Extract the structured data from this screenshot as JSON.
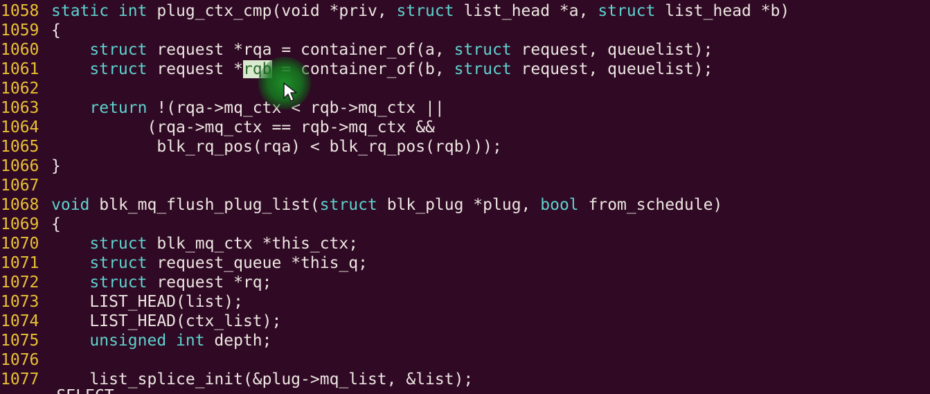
{
  "editor": {
    "background": "#300a24",
    "line_number_color": "#e8c232",
    "keyword_color": "#5ed2cf",
    "text_color": "#ede6e2",
    "status_text": "-- SELECT --"
  },
  "cursor": {
    "icon": "mouse-pointer-icon",
    "highlight": "green-click-highlight"
  },
  "lines": [
    {
      "num": "1058",
      "parts": [
        [
          "kw",
          "static int "
        ],
        [
          "txt",
          "plug_ctx_cmp(void *priv, "
        ],
        [
          "kw",
          "struct "
        ],
        [
          "txt",
          "list_head *a, "
        ],
        [
          "kw",
          "struct "
        ],
        [
          "txt",
          "list_head *b)"
        ]
      ]
    },
    {
      "num": "1059",
      "parts": [
        [
          "txt",
          "{"
        ]
      ]
    },
    {
      "num": "1060",
      "parts": [
        [
          "txt",
          "    "
        ],
        [
          "kw",
          "struct "
        ],
        [
          "txt",
          "request *rqa = container_of(a, "
        ],
        [
          "kw",
          "struct "
        ],
        [
          "txt",
          "request, queuelist);"
        ]
      ]
    },
    {
      "num": "1061",
      "parts": [
        [
          "txt",
          "    "
        ],
        [
          "kw",
          "struct "
        ],
        [
          "txt",
          "request *"
        ],
        [
          "hl",
          "rqb"
        ],
        [
          "txt",
          " = container_of(b, "
        ],
        [
          "kw",
          "struct "
        ],
        [
          "txt",
          "request, queuelist);"
        ]
      ]
    },
    {
      "num": "1062",
      "parts": [
        [
          "txt",
          ""
        ]
      ]
    },
    {
      "num": "1063",
      "parts": [
        [
          "txt",
          "    "
        ],
        [
          "kw",
          "return "
        ],
        [
          "txt",
          "!(rqa->mq_ctx < rqb->mq_ctx ||"
        ]
      ]
    },
    {
      "num": "1064",
      "parts": [
        [
          "txt",
          "          (rqa->mq_ctx == rqb->mq_ctx &&"
        ]
      ]
    },
    {
      "num": "1065",
      "parts": [
        [
          "txt",
          "           blk_rq_pos(rqa) < blk_rq_pos(rqb)));"
        ]
      ]
    },
    {
      "num": "1066",
      "parts": [
        [
          "txt",
          "}"
        ]
      ]
    },
    {
      "num": "1067",
      "parts": [
        [
          "txt",
          ""
        ]
      ]
    },
    {
      "num": "1068",
      "parts": [
        [
          "kw",
          "void "
        ],
        [
          "txt",
          "blk_mq_flush_plug_list("
        ],
        [
          "kw",
          "struct "
        ],
        [
          "txt",
          "blk_plug *plug, "
        ],
        [
          "kw",
          "bool "
        ],
        [
          "txt",
          "from_schedule)"
        ]
      ]
    },
    {
      "num": "1069",
      "parts": [
        [
          "txt",
          "{"
        ]
      ]
    },
    {
      "num": "1070",
      "parts": [
        [
          "txt",
          "    "
        ],
        [
          "kw",
          "struct "
        ],
        [
          "txt",
          "blk_mq_ctx *this_ctx;"
        ]
      ]
    },
    {
      "num": "1071",
      "parts": [
        [
          "txt",
          "    "
        ],
        [
          "kw",
          "struct "
        ],
        [
          "txt",
          "request_queue *this_q;"
        ]
      ]
    },
    {
      "num": "1072",
      "parts": [
        [
          "txt",
          "    "
        ],
        [
          "kw",
          "struct "
        ],
        [
          "txt",
          "request *rq;"
        ]
      ]
    },
    {
      "num": "1073",
      "parts": [
        [
          "txt",
          "    LIST_HEAD(list);"
        ]
      ]
    },
    {
      "num": "1074",
      "parts": [
        [
          "txt",
          "    LIST_HEAD(ctx_list);"
        ]
      ]
    },
    {
      "num": "1075",
      "parts": [
        [
          "txt",
          "    "
        ],
        [
          "kw",
          "unsigned int "
        ],
        [
          "txt",
          "depth;"
        ]
      ]
    },
    {
      "num": "1076",
      "parts": [
        [
          "txt",
          ""
        ]
      ]
    },
    {
      "num": "1077",
      "parts": [
        [
          "txt",
          "    list_splice_init(&plug->mq_list, &list);"
        ]
      ]
    }
  ]
}
